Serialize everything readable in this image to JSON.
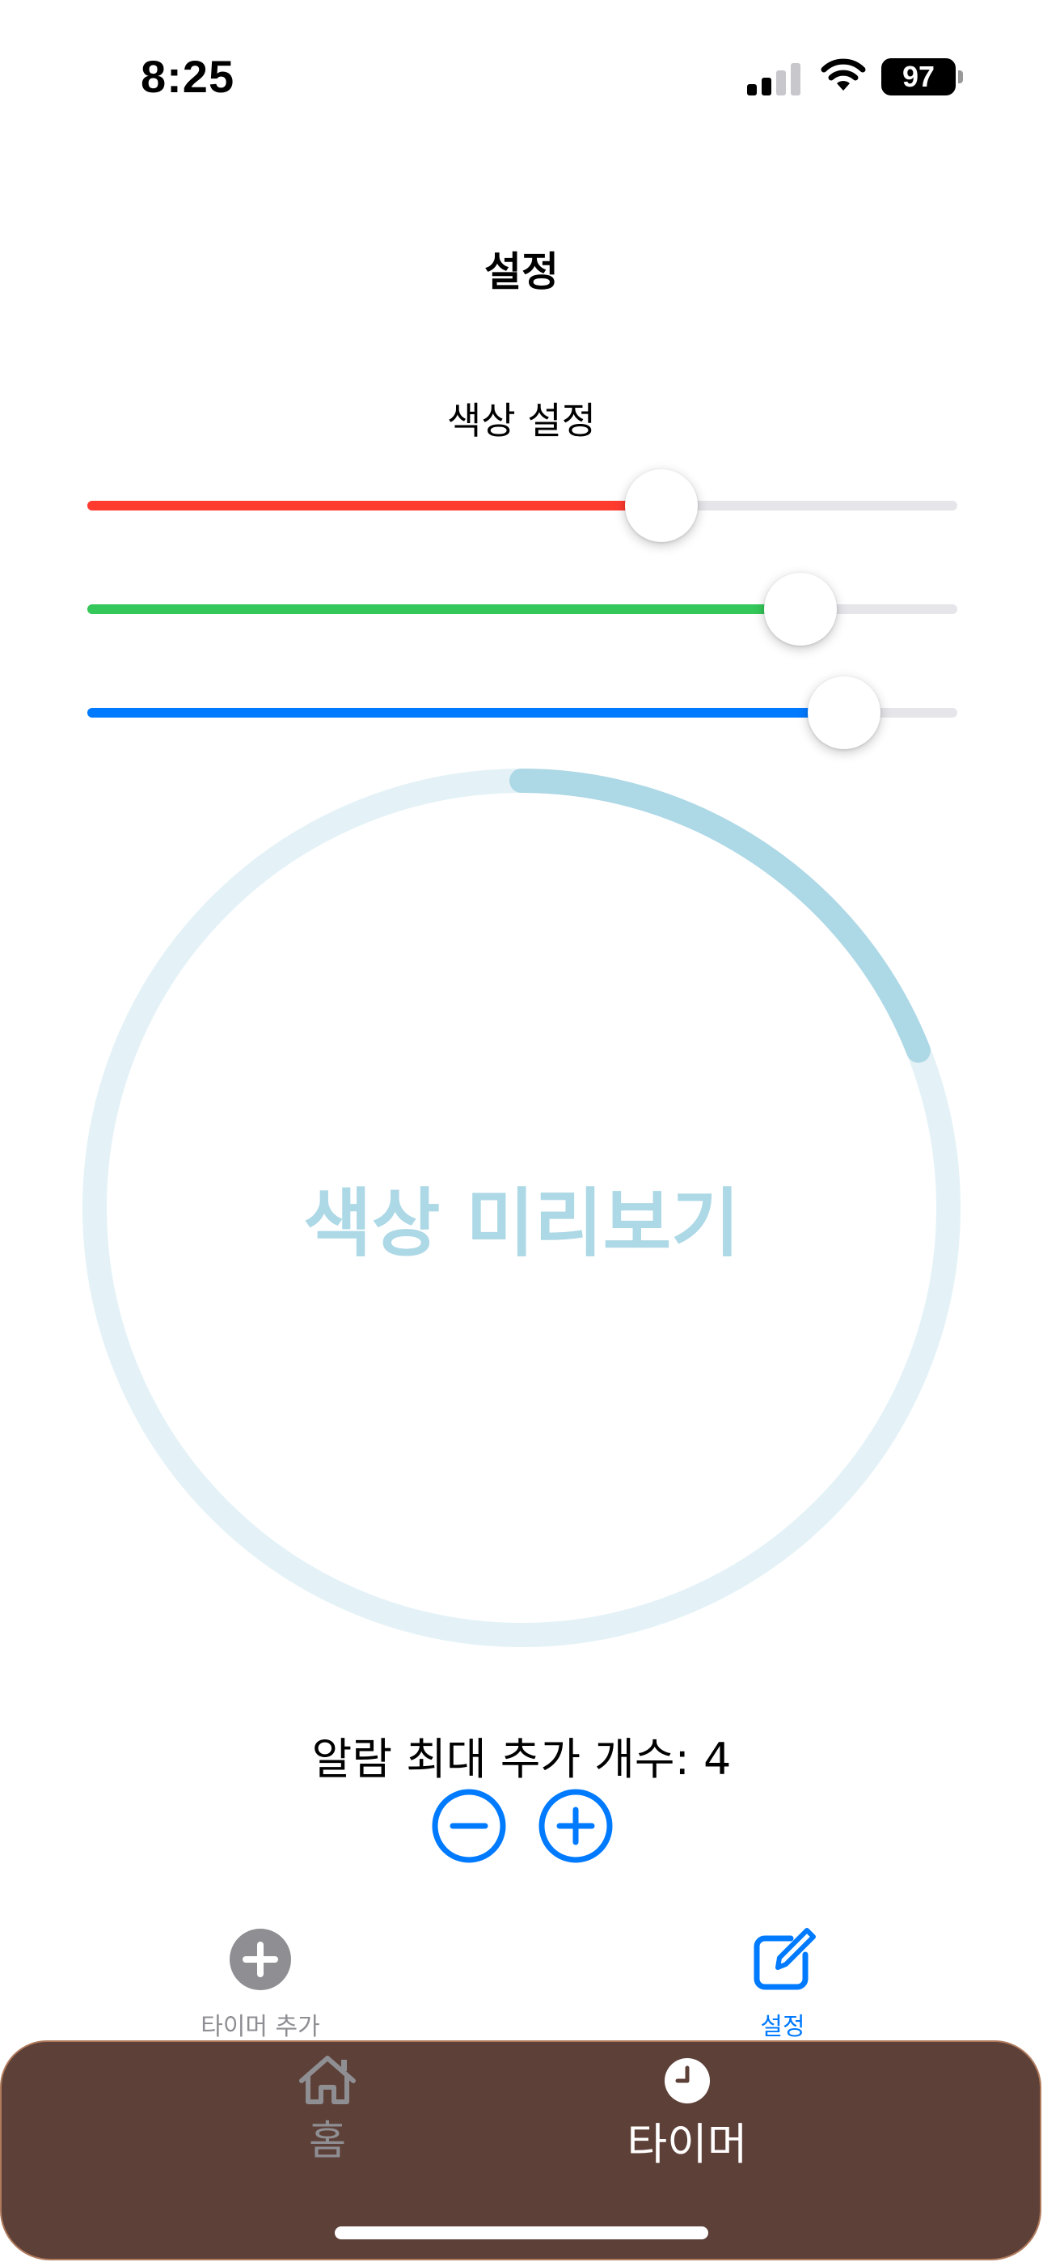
{
  "status_bar": {
    "time": "8:25",
    "battery": "97"
  },
  "nav": {
    "title": "설정"
  },
  "color_settings": {
    "title": "색상 설정",
    "sliders": [
      {
        "name": "red",
        "value": 0.66,
        "color": "#ff3b30"
      },
      {
        "name": "green",
        "value": 0.82,
        "color": "#34c759"
      },
      {
        "name": "blue",
        "value": 0.87,
        "color": "#007aff"
      }
    ]
  },
  "preview": {
    "label": "색상 미리보기",
    "color": "#add8e6",
    "progress": 0.19
  },
  "alarm": {
    "text": "알람 최대 추가 개수: 4",
    "max_count": 4,
    "decrement_icon": "minus-circle-icon",
    "increment_icon": "plus-circle-icon",
    "accent": "#007aff"
  },
  "tab_bar": {
    "items": [
      {
        "label": "타이머 추가",
        "icon": "plus-circle-fill-icon",
        "selected": false
      },
      {
        "label": "설정",
        "icon": "square-and-pencil-icon",
        "selected": true
      }
    ],
    "active_color": "#007aff",
    "inactive_color": "#8e8e93"
  },
  "bottom_bar": {
    "background": "#5d4037",
    "items": [
      {
        "label": "홈",
        "icon": "house-icon",
        "selected": false
      },
      {
        "label": "타이머",
        "icon": "clock-icon",
        "selected": true
      }
    ]
  }
}
